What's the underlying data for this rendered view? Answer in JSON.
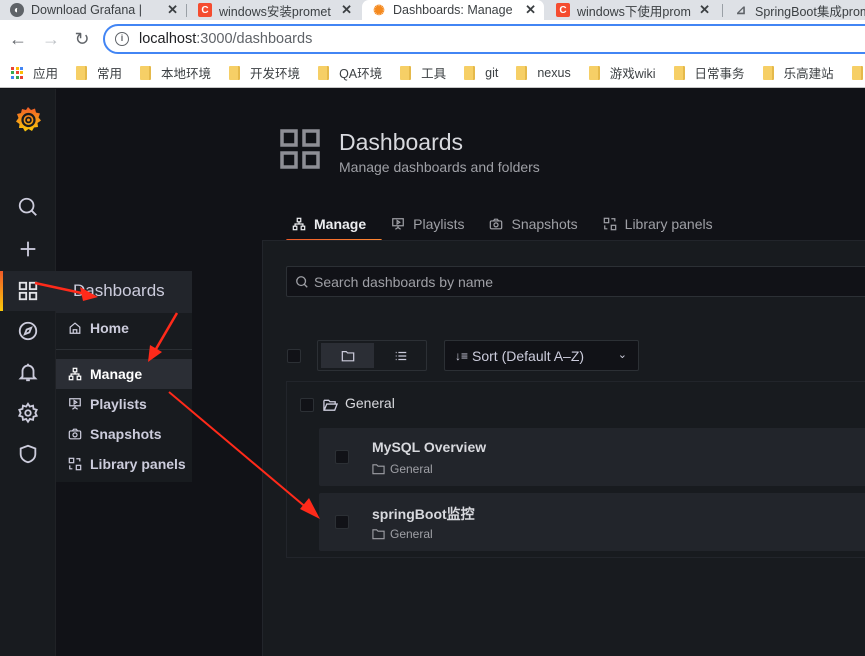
{
  "browser": {
    "tabs": [
      {
        "title": "Download Grafana |",
        "icon": "globe-icon",
        "active": false
      },
      {
        "title": "windows安装promet",
        "icon": "csdn-c-icon",
        "active": false
      },
      {
        "title": "Dashboards: Manage",
        "icon": "grafana-icon",
        "active": true
      },
      {
        "title": "windows下使用prom",
        "icon": "csdn-c-icon",
        "active": false
      },
      {
        "title": "SpringBoot集成prom",
        "icon": "page-icon",
        "active": false
      }
    ],
    "close_glyph": "✕",
    "url_host": "localhost",
    "url_path": ":3000/dashboards",
    "bookmarks": [
      {
        "label": "应用",
        "type": "apps"
      },
      {
        "label": "常用",
        "type": "folder"
      },
      {
        "label": "本地环境",
        "type": "folder"
      },
      {
        "label": "开发环境",
        "type": "folder"
      },
      {
        "label": "QA环境",
        "type": "folder"
      },
      {
        "label": "工具",
        "type": "folder"
      },
      {
        "label": "git",
        "type": "folder"
      },
      {
        "label": "nexus",
        "type": "folder"
      },
      {
        "label": "游戏wiki",
        "type": "folder"
      },
      {
        "label": "日常事务",
        "type": "folder"
      },
      {
        "label": "乐高建站",
        "type": "folder"
      },
      {
        "label": "ft",
        "type": "folder"
      }
    ]
  },
  "sidemenu": {
    "items": [
      "search",
      "create",
      "dashboards",
      "explore",
      "alerting",
      "configuration",
      "server-admin"
    ],
    "active": "dashboards"
  },
  "flyout": {
    "title": "Dashboards",
    "items": [
      {
        "label": "Home",
        "icon": "home-icon",
        "active": false
      },
      {
        "label": "Manage",
        "icon": "sitemap-icon",
        "active": true
      },
      {
        "label": "Playlists",
        "icon": "presentation-play-icon",
        "active": false
      },
      {
        "label": "Snapshots",
        "icon": "camera-icon",
        "active": false
      },
      {
        "label": "Library panels",
        "icon": "library-panel-icon",
        "active": false
      }
    ]
  },
  "page": {
    "title": "Dashboards",
    "subtitle": "Manage dashboards and folders",
    "tabs": [
      {
        "label": "Manage",
        "active": true
      },
      {
        "label": "Playlists",
        "active": false
      },
      {
        "label": "Snapshots",
        "active": false
      },
      {
        "label": "Library panels",
        "active": false
      }
    ],
    "search_placeholder": "Search dashboards by name",
    "sort_label": "Sort (Default A–Z)",
    "folder": {
      "name": "General"
    },
    "dashboards": [
      {
        "title": "MySQL Overview",
        "folder": "General"
      },
      {
        "title": "springBoot监控",
        "folder": "General"
      }
    ]
  },
  "colors": {
    "accent_orange": "#f05a28",
    "annotation_arrow": "#ff2a1a",
    "bg_canvas": "#111217",
    "bg_panel": "#181b1f"
  }
}
